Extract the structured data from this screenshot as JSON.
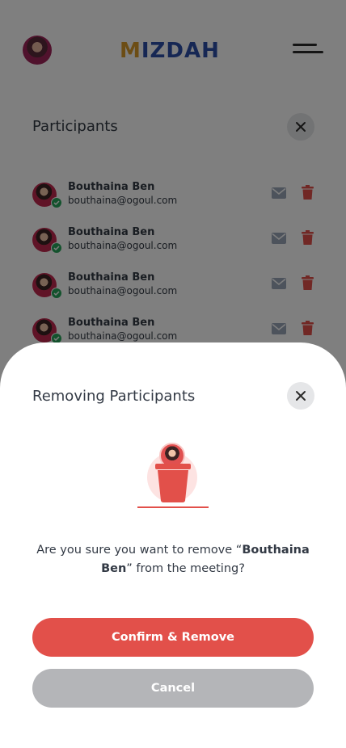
{
  "header": {
    "logo_first": "M",
    "logo_rest": "IZDAH",
    "avatar_icon": "user-avatar",
    "menu_icon": "hamburger-menu-icon"
  },
  "participants_sheet": {
    "title": "Participants",
    "close_icon": "close-icon",
    "participants": [
      {
        "name": "Bouthaina Ben",
        "email": "bouthaina@ogoul.com"
      },
      {
        "name": "Bouthaina Ben",
        "email": "bouthaina@ogoul.com"
      },
      {
        "name": "Bouthaina Ben",
        "email": "bouthaina@ogoul.com"
      },
      {
        "name": "Bouthaina Ben",
        "email": "bouthaina@ogoul.com"
      }
    ]
  },
  "remove_sheet": {
    "title": "Removing Participants",
    "close_icon": "close-icon",
    "message_prefix": "Are you sure you want to remove “",
    "message_name": "Bouthaina Ben",
    "message_suffix": "” from the meeting?",
    "confirm_label": "Confirm & Remove",
    "cancel_label": "Cancel"
  },
  "colors": {
    "accent_red": "#e2504a",
    "cancel_gray": "#b4b5b8",
    "verified_green": "#27a45a",
    "logo_blue": "#2c4fa8",
    "logo_gold": "#d99a2b"
  }
}
